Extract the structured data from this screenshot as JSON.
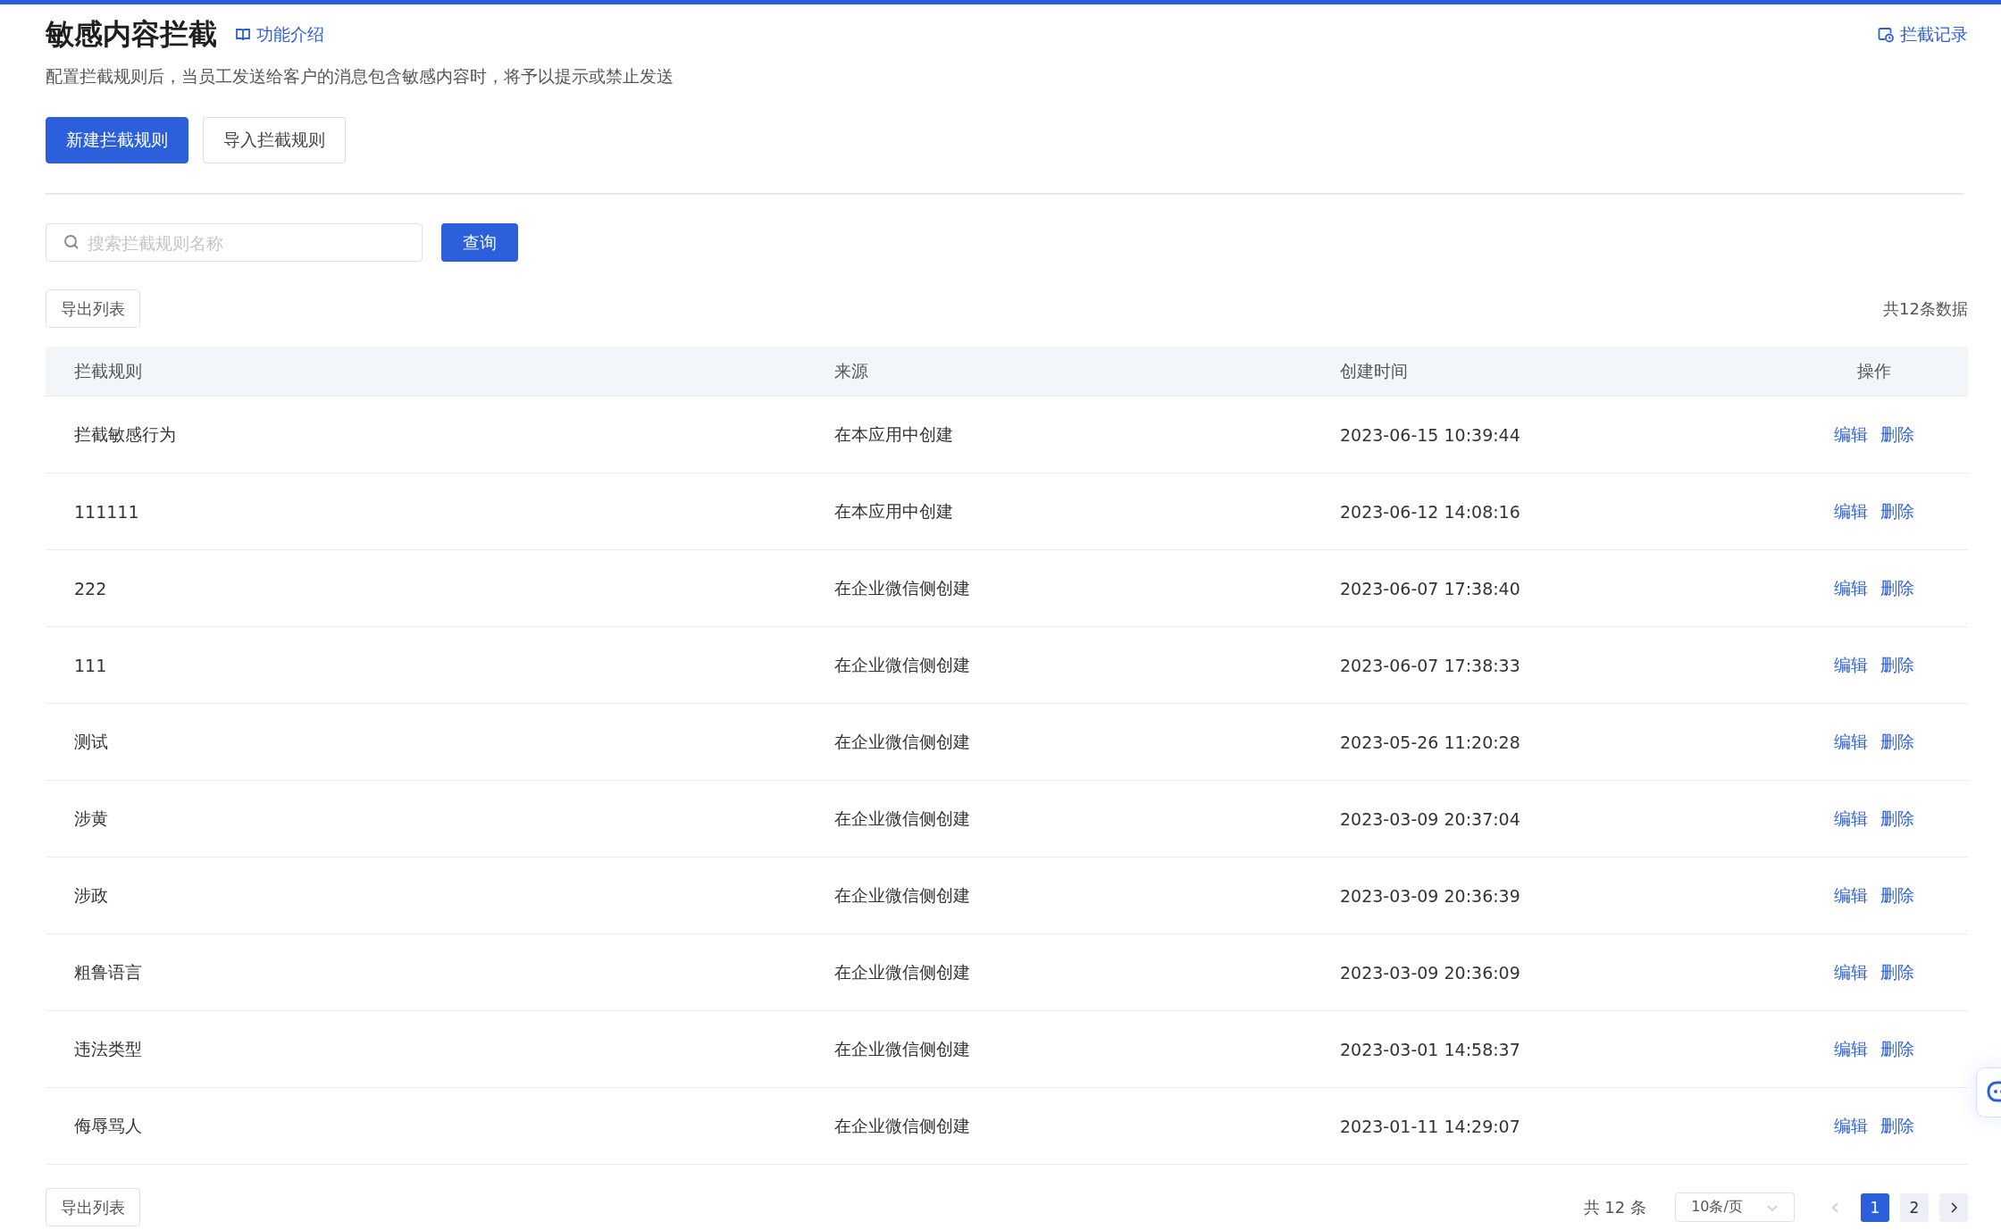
{
  "header": {
    "title": "敏感内容拦截",
    "intro_link": "功能介绍",
    "record_link": "拦截记录",
    "description": "配置拦截规则后，当员工发送给客户的消息包含敏感内容时，将予以提示或禁止发送"
  },
  "actions": [
    {
      "label": "新建拦截规则",
      "kind": "primary"
    },
    {
      "label": "导入拦截规则",
      "kind": "default"
    }
  ],
  "search": {
    "placeholder": "搜索拦截规则名称",
    "button": "查询"
  },
  "export_top": "导出列表",
  "total_summary": "共12条数据",
  "table": {
    "columns": [
      "拦截规则",
      "来源",
      "创建时间",
      "操作"
    ],
    "rows": [
      {
        "rule": "拦截敏感行为",
        "source": "在本应用中创建",
        "created": "2023-06-15 10:39:44",
        "actions": [
          "编辑",
          "删除"
        ]
      },
      {
        "rule": "111111",
        "source": "在本应用中创建",
        "created": "2023-06-12 14:08:16",
        "actions": [
          "编辑",
          "删除"
        ]
      },
      {
        "rule": "222",
        "source": "在企业微信侧创建",
        "created": "2023-06-07 17:38:40",
        "actions": [
          "编辑",
          "删除"
        ]
      },
      {
        "rule": "111",
        "source": "在企业微信侧创建",
        "created": "2023-06-07 17:38:33",
        "actions": [
          "编辑",
          "删除"
        ]
      },
      {
        "rule": "测试",
        "source": "在企业微信侧创建",
        "created": "2023-05-26 11:20:28",
        "actions": [
          "编辑",
          "删除"
        ]
      },
      {
        "rule": "涉黄",
        "source": "在企业微信侧创建",
        "created": "2023-03-09 20:37:04",
        "actions": [
          "编辑",
          "删除"
        ]
      },
      {
        "rule": "涉政",
        "source": "在企业微信侧创建",
        "created": "2023-03-09 20:36:39",
        "actions": [
          "编辑",
          "删除"
        ]
      },
      {
        "rule": "粗鲁语言",
        "source": "在企业微信侧创建",
        "created": "2023-03-09 20:36:09",
        "actions": [
          "编辑",
          "删除"
        ]
      },
      {
        "rule": "违法类型",
        "source": "在企业微信侧创建",
        "created": "2023-03-01 14:58:37",
        "actions": [
          "编辑",
          "删除"
        ]
      },
      {
        "rule": "侮辱骂人",
        "source": "在企业微信侧创建",
        "created": "2023-01-11 14:29:07",
        "actions": [
          "编辑",
          "删除"
        ]
      }
    ]
  },
  "export_bottom": "导出列表",
  "pagination": {
    "total": "共 12 条",
    "page_size": "10条/页",
    "prev_disabled": true,
    "pages": [
      {
        "label": "1",
        "selected": true
      },
      {
        "label": "2",
        "selected": false
      }
    ]
  }
}
